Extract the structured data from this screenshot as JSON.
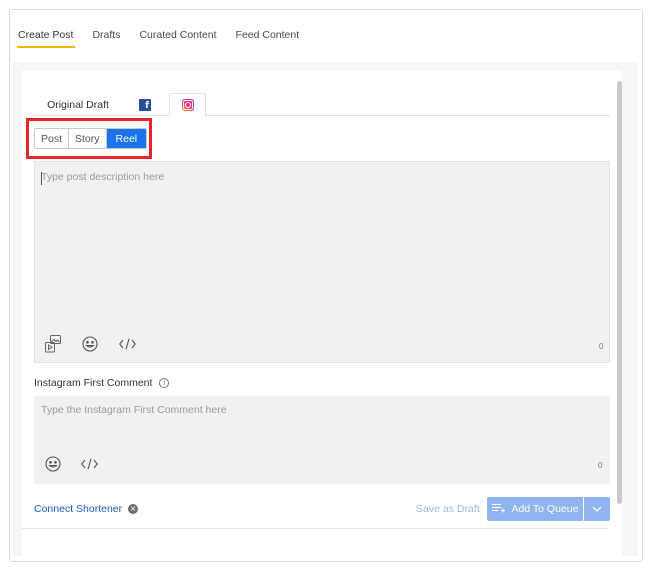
{
  "top_tabs": [
    {
      "label": "Create Post",
      "active": true
    },
    {
      "label": "Drafts",
      "active": false
    },
    {
      "label": "Curated Content",
      "active": false
    },
    {
      "label": "Feed Content",
      "active": false
    }
  ],
  "network_tabs": {
    "original_label": "Original Draft",
    "facebook_icon": "facebook-icon",
    "instagram_icon": "instagram-icon",
    "active": "instagram"
  },
  "post_types": [
    {
      "label": "Post",
      "active": false
    },
    {
      "label": "Story",
      "active": false
    },
    {
      "label": "Reel",
      "active": true
    }
  ],
  "description": {
    "placeholder": "Type post description here",
    "value": "",
    "counter": "0",
    "toolbar_icons": [
      "media-icon",
      "emoji-icon",
      "code-icon"
    ]
  },
  "first_comment": {
    "label": "Instagram First Comment",
    "placeholder": "Type the Instagram First Comment here",
    "counter": "0",
    "toolbar_icons": [
      "emoji-icon",
      "code-icon"
    ]
  },
  "footer": {
    "connect_shortener": "Connect Shortener",
    "save_draft": "Save as Draft",
    "add_to_queue": "Add To Queue"
  },
  "colors": {
    "accent": "#1a73e8",
    "tab_underline": "#f5b400",
    "highlight": "#e8262a",
    "queue_button": "#8fb4ef"
  }
}
